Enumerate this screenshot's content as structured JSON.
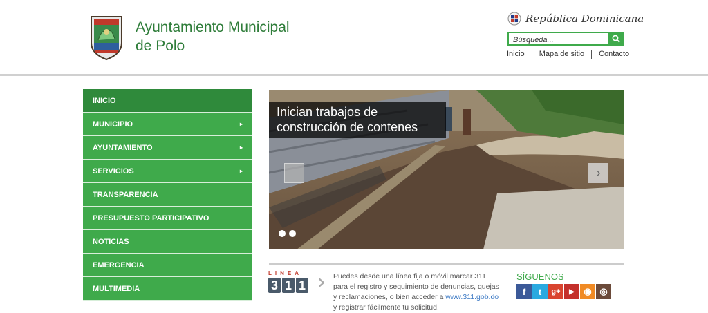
{
  "header": {
    "title_line1": "Ayuntamiento Municipal",
    "title_line2": "de Polo",
    "country_label": "República Dominicana",
    "search_placeholder": "Búsqueda...",
    "links": [
      "Inicio",
      "Mapa de sitio",
      "Contacto"
    ]
  },
  "menu": {
    "items": [
      {
        "label": "INICIO",
        "submenu": false
      },
      {
        "label": "MUNICIPIO",
        "submenu": true
      },
      {
        "label": "AYUNTAMIENTO",
        "submenu": true
      },
      {
        "label": "SERVICIOS",
        "submenu": true
      },
      {
        "label": "TRANSPARENCIA",
        "submenu": false
      },
      {
        "label": "PRESUPUESTO PARTICIPATIVO",
        "submenu": false
      },
      {
        "label": "NOTICIAS",
        "submenu": false
      },
      {
        "label": "EMERGENCIA",
        "submenu": false
      },
      {
        "label": "MULTIMEDIA",
        "submenu": false
      }
    ],
    "arrow_glyph": "▸"
  },
  "slider": {
    "caption_line1": "Inician trabajos de",
    "caption_line2": "construcción de contenes",
    "next_glyph": "›",
    "slide_count": 2
  },
  "linea311": {
    "label": "LINEA",
    "digits": [
      "3",
      "1",
      "1"
    ],
    "text_before_link": "Puedes desde una línea fija o móvil marcar 311 para el registro y seguimiento de denuncias, quejas y reclamaciones, o bien acceder a ",
    "link": "www.311.gob.do",
    "text_after_link": " y registrar fácilmente tu solicitud."
  },
  "social": {
    "heading": "SÍGUENOS",
    "icons": [
      {
        "name": "facebook-icon",
        "glyph": "f",
        "color": "#3b5998"
      },
      {
        "name": "twitter-icon",
        "glyph": "t",
        "color": "#2aa9e0"
      },
      {
        "name": "googleplus-icon",
        "glyph": "g+",
        "color": "#d9442f"
      },
      {
        "name": "youtube-icon",
        "glyph": "▶",
        "color": "#c4302b"
      },
      {
        "name": "rss-icon",
        "glyph": "◉",
        "color": "#f08a24"
      },
      {
        "name": "instagram-icon",
        "glyph": "◎",
        "color": "#6b4a3a"
      }
    ]
  },
  "colors": {
    "accent": "#3faa4b",
    "menu_active": "#2f8a3b",
    "title": "#2f7d3a"
  }
}
